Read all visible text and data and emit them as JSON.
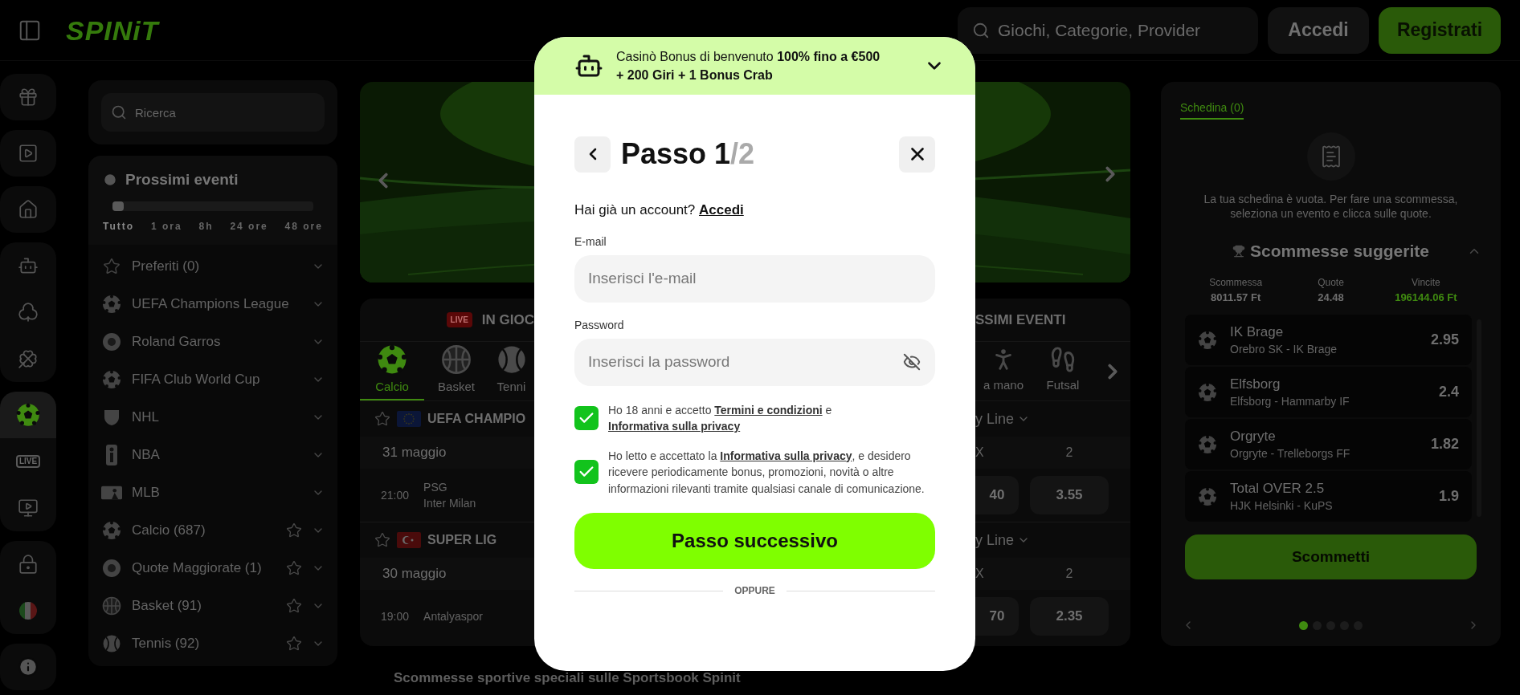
{
  "header": {
    "logo": "SPINiT",
    "search_placeholder": "Giochi, Categorie, Provider",
    "buttons": [
      {
        "label": "Accedi",
        "kind": "secondary"
      },
      {
        "label": "Registrati",
        "kind": "primary"
      }
    ]
  },
  "rail": [
    {
      "items": [
        {
          "selected": false
        }
      ]
    },
    {
      "items": [
        {
          "selected": false
        }
      ]
    },
    {
      "items": [
        {
          "selected": false
        }
      ]
    },
    {
      "items": [
        {
          "selected": false
        },
        {
          "selected": false
        },
        {
          "selected": false
        }
      ]
    },
    {
      "items": [
        {
          "selected": true
        },
        {
          "selected": false,
          "label": "LIVE"
        },
        {
          "selected": false
        }
      ]
    },
    {
      "items": [
        {
          "selected": false
        },
        {
          "selected": false
        }
      ]
    },
    {
      "items": [
        {
          "selected": false
        }
      ]
    }
  ],
  "sidebar": {
    "search_placeholder": "Ricerca",
    "upcoming_title": "Prossimi eventi",
    "slider": {
      "level": 0
    },
    "ticks": [
      {
        "label": "Tutto",
        "selected": true
      },
      {
        "label": "1 ora",
        "selected": false
      },
      {
        "label": "8h",
        "selected": false
      },
      {
        "label": "24 ore",
        "selected": false
      },
      {
        "label": "48 ore",
        "selected": false
      }
    ],
    "items": [
      {
        "label": "Preferiti (0)",
        "kind": "league"
      },
      {
        "label": "UEFA Champions League",
        "kind": "league"
      },
      {
        "label": "Roland Garros",
        "kind": "league"
      },
      {
        "label": "FIFA Club World Cup",
        "kind": "league"
      },
      {
        "label": "NHL",
        "kind": "league"
      },
      {
        "label": "NBA",
        "kind": "league"
      },
      {
        "label": "MLB",
        "kind": "league"
      },
      {
        "label": "Calcio (687)",
        "kind": "sport"
      },
      {
        "label": "Quote Maggiorate (1)",
        "kind": "sport"
      },
      {
        "label": "Basket (91)",
        "kind": "sport"
      },
      {
        "label": "Tennis (92)",
        "kind": "sport"
      }
    ]
  },
  "events": {
    "live_badge": "LIVE",
    "live_title": "IN GIOC",
    "upcoming_title": "SSIMI EVENTI",
    "tabs_left": [
      {
        "label": "Calcio",
        "selected": true
      },
      {
        "label": "Basket",
        "selected": false
      },
      {
        "label": "Tenni",
        "selected": false
      }
    ],
    "tabs_right": [
      {
        "label": "a mano",
        "selected": false
      },
      {
        "label": "Futsal",
        "selected": false
      }
    ],
    "competitions": [
      {
        "name": "UEFA CHAMPIO",
        "date": "31 maggio",
        "time": "21:00",
        "teams": [
          "PSG",
          "Inter Milan"
        ],
        "market": "y Line",
        "columns": [
          "X",
          "2"
        ],
        "odds": [
          "40",
          "3.55"
        ]
      },
      {
        "name": "SUPER LIG",
        "date": "30 maggio",
        "time": "19:00",
        "teams": [
          "Antalyaspor"
        ],
        "market": "y Line",
        "columns": [
          "X",
          "2"
        ],
        "odds": [
          "70",
          "2.35"
        ]
      }
    ]
  },
  "footer_text": "Scommesse sportive speciali sulle Sportsbook Spinit",
  "betslip": {
    "tab": {
      "label": "Schedina (0)",
      "selected": true
    },
    "empty_text": "La tua schedina è vuota. Per fare una scommessa, seleziona un evento e clicca sulle quote.",
    "suggested_title": "Scommesse suggerite",
    "summary": [
      {
        "label": "Scommessa",
        "value": "8011.57 Ft",
        "kind": "plain"
      },
      {
        "label": "Quote",
        "value": "24.48",
        "kind": "plain"
      },
      {
        "label": "Vincite",
        "value": "196144.06 Ft",
        "kind": "win"
      }
    ],
    "bets": [
      {
        "pick": "IK Brage",
        "match": "Orebro SK - IK Brage",
        "odds": "2.95"
      },
      {
        "pick": "Elfsborg",
        "match": "Elfsborg - Hammarby IF",
        "odds": "2.4"
      },
      {
        "pick": "Orgryte",
        "match": "Orgryte - Trelleborgs FF",
        "odds": "1.82"
      },
      {
        "pick": "Total OVER 2.5",
        "match": "HJK Helsinki - KuPS",
        "odds": "1.9"
      }
    ],
    "button": "Scommetti",
    "dots": [
      {
        "selected": true
      },
      {
        "selected": false
      },
      {
        "selected": false
      },
      {
        "selected": false
      },
      {
        "selected": false
      }
    ]
  },
  "modal": {
    "promo": "Casinò Bonus di benvenuto **100% fino a €500 + 200 Giri + 1 Bonus Crab**",
    "title": "Passo 1",
    "title_suffix": "/2",
    "login_prompt": "Hai già un account? ",
    "login_link": "Accedi",
    "fields": [
      {
        "label": "E-mail",
        "placeholder": "Inserisci l'e-mail",
        "kind": "text"
      },
      {
        "label": "Password",
        "placeholder": "Inserisci la password",
        "kind": "password"
      }
    ],
    "consents": [
      {
        "checked": true,
        "parts": [
          {
            "kind": "text",
            "text": "Ho 18 anni e accetto "
          },
          {
            "kind": "link",
            "text": "Termini e condizioni"
          },
          {
            "kind": "text",
            "text": " e "
          },
          {
            "kind": "link",
            "text": "Informativa sulla privacy"
          }
        ]
      },
      {
        "checked": true,
        "parts": [
          {
            "kind": "text",
            "text": "Ho letto e accettato la "
          },
          {
            "kind": "link",
            "text": "Informativa sulla privacy"
          },
          {
            "kind": "text",
            "text": ", e desidero ricevere periodicamente bonus, promozioni, novità o altre informazioni rilevanti tramite qualsiasi canale di comunicazione."
          }
        ]
      }
    ],
    "submit": "Passo successivo",
    "divider": "OPPURE"
  }
}
